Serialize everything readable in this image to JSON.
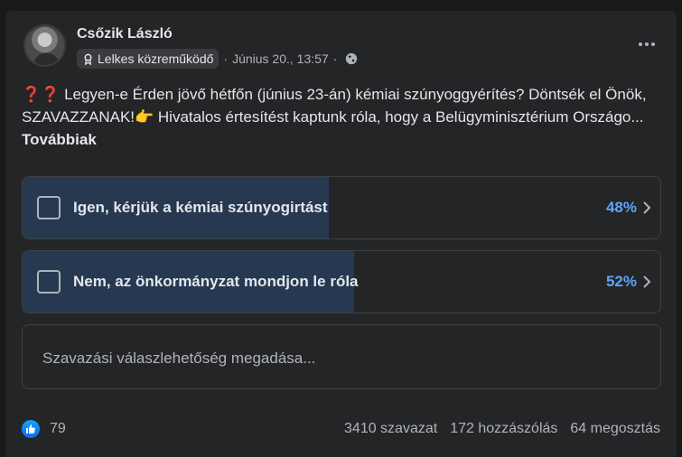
{
  "post": {
    "author": "Csőzik László",
    "badge_label": "Lelkes közreműködő",
    "timestamp": "Június 20., 13:57",
    "separator": "·",
    "text_main": " Legyen-e Érden jövő hétfőn (június 23-án) kémiai szúnyoggyérítés? Döntsék el Önök, SZAVAZZANAK!👉 Hivatalos értesítést kaptunk róla, hogy a Belügyminisztérium Országo... ",
    "qmarks": "❓❓",
    "see_more": "Továbbiak"
  },
  "poll": {
    "options": [
      {
        "label": "Igen, kérjük a kémiai szúnyogirtást",
        "percent_label": "48%",
        "percent": 48
      },
      {
        "label": "Nem, az önkormányzat mondjon le róla",
        "percent_label": "52%",
        "percent": 52
      }
    ],
    "add_option_placeholder": "Szavazási válaszlehetőség megadása..."
  },
  "footer": {
    "likes": "79",
    "votes": "3410 szavazat",
    "comments": "172 hozzászólás",
    "shares": "64 megosztás"
  },
  "colors": {
    "accent": "#5aa7ff",
    "poll_fill": "#263951",
    "card_bg": "#242526"
  },
  "icons": {
    "badge": "badge-icon",
    "globe": "globe-icon",
    "more": "more-icon",
    "like": "like-icon",
    "chevron": "chevron-right-icon"
  }
}
